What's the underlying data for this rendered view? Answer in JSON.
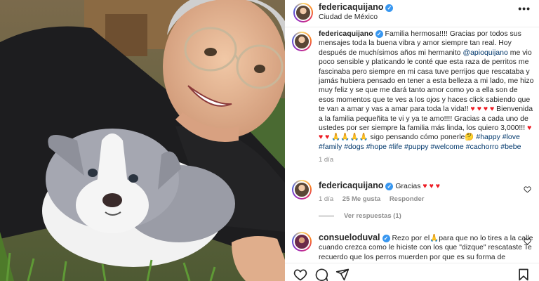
{
  "post": {
    "username": "federicaquijano",
    "location": "Ciudad de México",
    "more_label": "•••"
  },
  "caption": {
    "username": "federicaquijano",
    "text_1": "Familia hermosa!!!! Gracias por todos sus mensajes toda la buena vibra y amor siempre tan real. Hoy después de muchísimos años mi hermanito",
    "mention": "@apioquijano",
    "text_2": "me vio poco sensible y platicando le conté que esta raza de perritos me fascinaba pero siempre en mi casa tuve perrijos que rescataba y jamás hubiera pensado en tener a esta belleza a mi lado, me hizo muy feliz y se que me dará tanto amor como yo a ella son de esos momentos que te ves a los ojos y haces click sabiendo que te van a amar y vas a amar para toda la vida!!",
    "hearts_1": " ♥",
    "hearts_2": "♥ ♥ ♥",
    "text_3": " Bienvenida a la familia pequeñita te vi y ya te amo!!!! Gracias a cada uno de ustedes por ser siempre la familia más linda, los quiero 3,000!!!",
    "hearts_3": " ♥ ♥ ♥",
    "text_4": " 🙏🙏🙏🙏 sigo pensando cómo ponerle🤔",
    "hashtags": [
      "#happy",
      "#love",
      "#family",
      "#dogs",
      "#hope",
      "#life",
      "#puppy",
      "#welcome",
      "#cachorro",
      "#bebe"
    ],
    "time": "1 día"
  },
  "comments": [
    {
      "username": "federicaquijano",
      "text": "Gracias",
      "hearts": " ♥ ♥ ♥",
      "time": "1 día",
      "likes": "25 Me gusta",
      "reply": "Responder"
    },
    {
      "username": "consueloduval",
      "text": "Rezo por el🙏para que no lo tires a la calle cuando crezca como le hiciste con los que \"dizque\" rescataste Te recuerdo que los perros muerden por que es su forma de"
    }
  ],
  "replies_label": "Ver respuestas (1)",
  "icons": {
    "like": "heart-icon",
    "comment": "comment-icon",
    "share": "share-icon",
    "save": "bookmark-icon"
  },
  "colors": {
    "link": "#00376b",
    "verified": "#3897f0",
    "heart": "#ed1c24",
    "muted": "#8e8e8e"
  }
}
